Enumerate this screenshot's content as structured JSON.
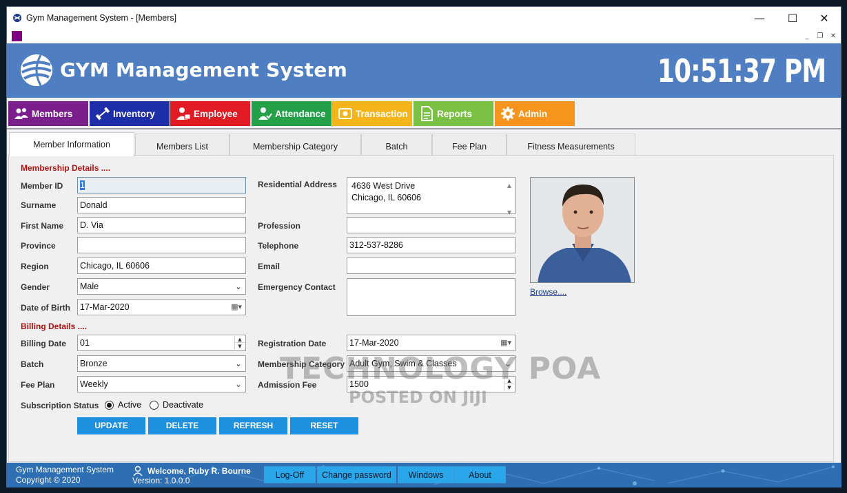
{
  "window": {
    "title": "Gym Management System - [Members]",
    "controls": {
      "minimize": "—",
      "maximize": "☐",
      "close": "✕"
    }
  },
  "mdi": {
    "controls": {
      "minimize": "_",
      "restore": "❐",
      "close": "✕"
    }
  },
  "header": {
    "title": "GYM Management System",
    "clock": "10:51:37 PM"
  },
  "nav": [
    {
      "label": "Members",
      "icon": "members-icon",
      "color": "#7b1f8c"
    },
    {
      "label": "Inventory",
      "icon": "dumbbell-icon",
      "color": "#1d2ea8"
    },
    {
      "label": "Employee",
      "icon": "employee-icon",
      "color": "#e01b24"
    },
    {
      "label": "Attendance",
      "icon": "attendance-icon",
      "color": "#24a148"
    },
    {
      "label": "Transaction",
      "icon": "transaction-icon",
      "color": "#f4b41a"
    },
    {
      "label": "Reports",
      "icon": "reports-icon",
      "color": "#7ac143"
    },
    {
      "label": "Admin",
      "icon": "gear-icon",
      "color": "#f7941d"
    }
  ],
  "tabs": [
    "Member Information",
    "Members List",
    "Membership Category",
    "Batch",
    "Fee Plan",
    "Fitness Measurements"
  ],
  "membership": {
    "section_title": "Membership Details ....",
    "member_id": {
      "label": "Member ID",
      "value": "1"
    },
    "surname": {
      "label": "Surname",
      "value": "Donald"
    },
    "first_name": {
      "label": "First Name",
      "value": "D. Via"
    },
    "province": {
      "label": "Province",
      "value": ""
    },
    "region": {
      "label": "Region",
      "value": "Chicago, IL 60606"
    },
    "gender": {
      "label": "Gender",
      "value": "Male"
    },
    "dob": {
      "label": "Date of Birth",
      "value": "17-Mar-2020"
    },
    "address": {
      "label": "Residential Address",
      "line1": "4636 West Drive",
      "line2": "Chicago, IL 60606"
    },
    "profession": {
      "label": "Profession",
      "value": ""
    },
    "telephone": {
      "label": "Telephone",
      "value": "312-537-8286"
    },
    "email": {
      "label": "Email",
      "value": ""
    },
    "emergency": {
      "label": "Emergency Contact",
      "value": ""
    }
  },
  "billing": {
    "section_title": "Billing Details ....",
    "billing_date": {
      "label": "Billing Date",
      "value": "01"
    },
    "batch": {
      "label": "Batch",
      "value": "Bronze"
    },
    "fee_plan": {
      "label": "Fee Plan",
      "value": "Weekly"
    },
    "registration_date": {
      "label": "Registration Date",
      "value": "17-Mar-2020"
    },
    "membership_category": {
      "label": "Membership Category",
      "value": "Adult Gym, Swim & Classes"
    },
    "admission_fee": {
      "label": "Admission Fee",
      "value": "1500"
    },
    "subscription": {
      "label": "Subscription Status",
      "active": "Active",
      "deactivate": "Deactivate",
      "selected": "Active"
    }
  },
  "actions": [
    "UPDATE",
    "DELETE",
    "REFRESH",
    "RESET"
  ],
  "photo": {
    "browse": "Browse...."
  },
  "watermark": {
    "line1": "TECHNOLOGY POA",
    "line2": "POSTED ON JIJI"
  },
  "footer": {
    "app": "Gym Management System",
    "copyright": "Copyright  © 2020",
    "welcome": "Welcome, Ruby R. Bourne",
    "version": "Version: 1.0.0.0",
    "buttons": [
      "Log-Off",
      "Change password",
      "Windows",
      "About"
    ]
  }
}
